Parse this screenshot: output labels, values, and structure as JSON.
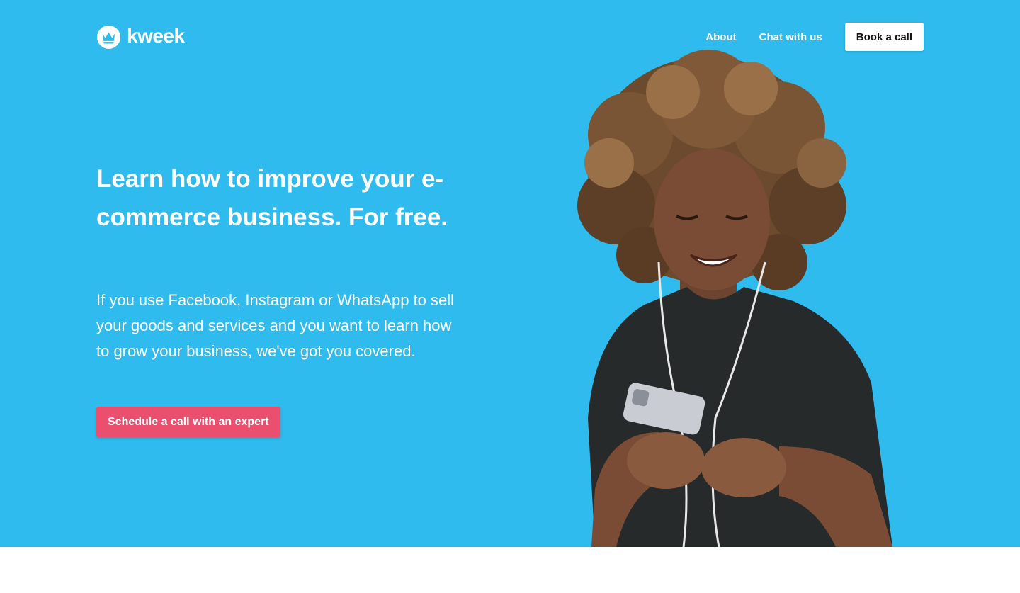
{
  "brand": {
    "name": "kweek",
    "logo_icon": "crown-icon"
  },
  "nav": {
    "links": [
      {
        "label": "About"
      },
      {
        "label": "Chat with us"
      }
    ],
    "cta_label": "Book a call"
  },
  "hero": {
    "headline": "Learn how to improve your e-commerce business. For free.",
    "subcopy": "If you use Facebook, Instagram or WhatsApp to sell your goods and services and you want to learn how to grow your business, we've got you covered.",
    "cta_label": "Schedule a call with an expert",
    "image_subject": "woman-with-phone-photo"
  },
  "colors": {
    "hero_background": "#2fbbed",
    "cta_background": "#ea4f6e",
    "nav_button_background": "#ffffff",
    "page_background": "#ffffff"
  }
}
